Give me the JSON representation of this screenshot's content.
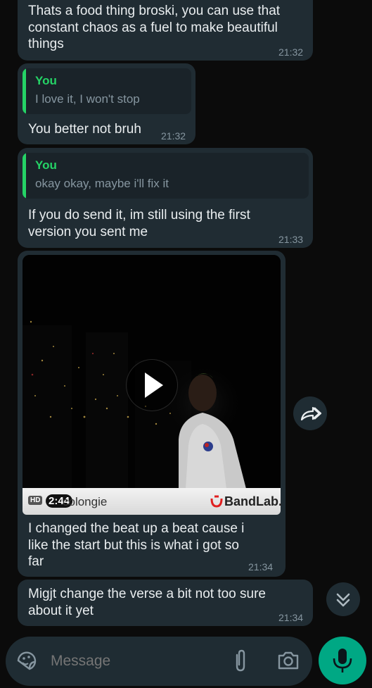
{
  "messages": [
    {
      "text": "Thats a food thing broski, you can use that\nconstant chaos as a fuel to make beautiful\nthings",
      "time": "21:32"
    },
    {
      "quote_author": "You",
      "quote_text": "I love it, I won't stop",
      "text": "You better not bruh",
      "time": "21:32"
    },
    {
      "quote_author": "You",
      "quote_text": "okay okay, maybe i'll fix it",
      "text": "If you do send it, im still using the first\nversion you sent me",
      "time": "21:33"
    },
    {
      "video": {
        "hd": "HD",
        "duration": "2:44",
        "title": "colongie",
        "brand": "BandLab."
      },
      "text": "I changed the beat up a beat cause i\nlike the start but this is what i got so\nfar",
      "time": "21:34"
    },
    {
      "text": "Migjt change the verse a bit not too sure\nabout it yet",
      "time": "21:34"
    }
  ],
  "composer": {
    "placeholder": "Message"
  },
  "icons": {
    "sticker": "sticker-icon",
    "attach": "paperclip-icon",
    "camera": "camera-icon",
    "mic": "microphone-icon",
    "forward": "forward-icon",
    "scroll": "double-chevron-down-icon",
    "play": "play-icon"
  },
  "colors": {
    "bubble": "#202c33",
    "accent": "#25d366",
    "mic_button": "#00a884",
    "background": "#0b0b0b"
  }
}
